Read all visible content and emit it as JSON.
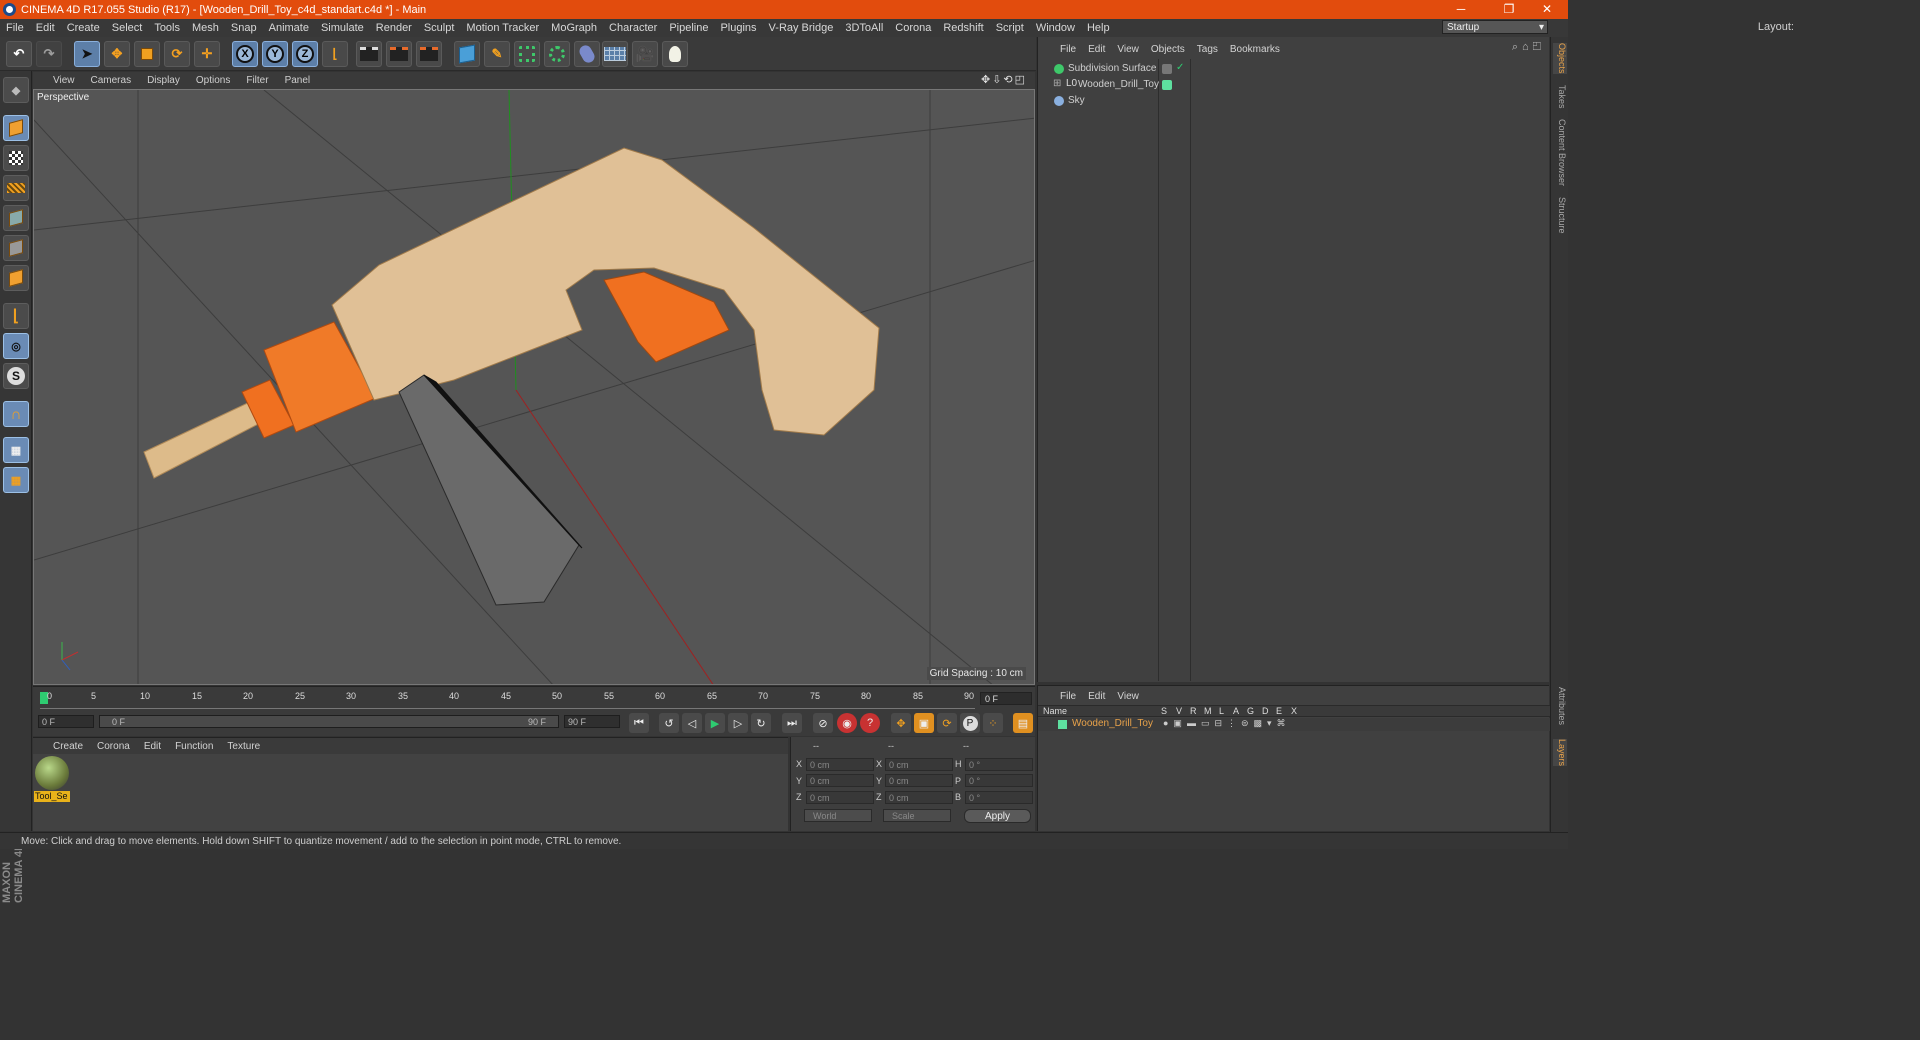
{
  "window": {
    "title": "CINEMA 4D R17.055 Studio (R17) - [Wooden_Drill_Toy_c4d_standart.c4d *] - Main",
    "minimize": "─",
    "restore": "❐",
    "close": "✕"
  },
  "menubar": [
    "File",
    "Edit",
    "Create",
    "Select",
    "Tools",
    "Mesh",
    "Snap",
    "Animate",
    "Simulate",
    "Render",
    "Sculpt",
    "Motion Tracker",
    "MoGraph",
    "Character",
    "Pipeline",
    "Plugins",
    "V-Ray Bridge",
    "3DToAll",
    "Corona",
    "Redshift",
    "Script",
    "Window",
    "Help"
  ],
  "layout": {
    "label": "Layout:",
    "value": "Startup"
  },
  "toolbar": {
    "undo_icon": "undo-icon",
    "axis_x": "X",
    "axis_y": "Y",
    "axis_z": "Z"
  },
  "viewport": {
    "menu": [
      "View",
      "Cameras",
      "Display",
      "Options",
      "Filter",
      "Panel"
    ],
    "nav_icons": "✥⇩⟲◰",
    "label": "Perspective",
    "grid_spacing": "Grid Spacing : 10 cm"
  },
  "timeline": {
    "ticks": [
      "0",
      "5",
      "10",
      "15",
      "20",
      "25",
      "30",
      "35",
      "40",
      "45",
      "50",
      "55",
      "60",
      "65",
      "70",
      "75",
      "80",
      "85",
      "90"
    ],
    "current_frame": "0 F",
    "start_field": "0 F",
    "range_start": "0 F",
    "range_end": "90 F",
    "end_field": "90 F"
  },
  "material_manager": {
    "menu": [
      "Create",
      "Corona",
      "Edit",
      "Function",
      "Texture"
    ],
    "materials": [
      {
        "name": "Tool_Se"
      }
    ]
  },
  "coordinates": {
    "header": [
      "--",
      "--",
      "--"
    ],
    "rows": [
      {
        "l1": "X",
        "v1": "0 cm",
        "l2": "X",
        "v2": "0 cm",
        "l3": "H",
        "v3": "0 °"
      },
      {
        "l1": "Y",
        "v1": "0 cm",
        "l2": "Y",
        "v2": "0 cm",
        "l3": "P",
        "v3": "0 °"
      },
      {
        "l1": "Z",
        "v1": "0 cm",
        "l2": "Z",
        "v2": "0 cm",
        "l3": "B",
        "v3": "0 °"
      }
    ],
    "space": "World",
    "mode": "Scale",
    "apply": "Apply"
  },
  "objects": {
    "menu": [
      "File",
      "Edit",
      "View",
      "Objects",
      "Tags",
      "Bookmarks"
    ],
    "tree": [
      {
        "name": "Subdivision Surface"
      },
      {
        "name": "Wooden_Drill_Toy"
      },
      {
        "name": "Sky"
      }
    ]
  },
  "layers": {
    "menu": [
      "File",
      "Edit",
      "View"
    ],
    "columns": [
      "Name",
      "S",
      "V",
      "R",
      "M",
      "L",
      "A",
      "G",
      "D",
      "E",
      "X"
    ],
    "rows": [
      {
        "name": "Wooden_Drill_Toy",
        "color": "#5ee0a0"
      }
    ]
  },
  "side_tabs": [
    "Objects",
    "Takes",
    "Content Browser",
    "Structure",
    "Attributes",
    "Layers"
  ],
  "status": "Move: Click and drag to move elements. Hold down SHIFT to quantize movement / add to the selection in point mode, CTRL to remove.",
  "brand": "MAXON CINEMA 4D",
  "colors": {
    "accent": "#e24c0d",
    "wood": "#e0c096",
    "orange": "#f07020",
    "grip": "#6a6a6a"
  }
}
